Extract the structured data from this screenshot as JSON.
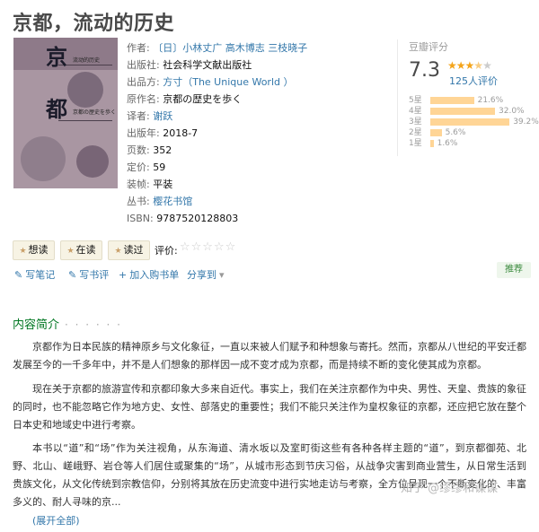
{
  "book": {
    "title": "京都，流动的历史",
    "info": [
      {
        "label": "作者:",
        "value": "〔日〕小林丈广 高木博志 三枝晓子",
        "link": true
      },
      {
        "label": "出版社:",
        "value": "社会科学文献出版社",
        "link": false
      },
      {
        "label": "出品方:",
        "value": "方寸（The Unique World ）",
        "link": true
      },
      {
        "label": "原作名:",
        "value": "京都の歴史を歩く",
        "link": false
      },
      {
        "label": "译者:",
        "value": "谢跃",
        "link": true
      },
      {
        "label": "出版年:",
        "value": "2018-7",
        "link": false
      },
      {
        "label": "页数:",
        "value": "352",
        "link": false
      },
      {
        "label": "定价:",
        "value": "59",
        "link": false
      },
      {
        "label": "装帧:",
        "value": "平装",
        "link": false
      },
      {
        "label": "丛书:",
        "value": "樱花书馆",
        "link": true
      },
      {
        "label": "ISBN:",
        "value": "9787520128803",
        "link": false
      }
    ],
    "cover": {
      "chars": [
        "京",
        "都"
      ],
      "small_text": [
        "流动的历史",
        "京都の歴史を歩く"
      ],
      "colors": {
        "bg": "#a996a2",
        "band": "#8e7a89"
      }
    }
  },
  "rating": {
    "label": "豆瓣评分",
    "score": "7.3",
    "stars_filled": 3.5,
    "count": "125人评价",
    "breakdown": [
      {
        "label": "5星",
        "pct": "21.6%",
        "value": 21.6
      },
      {
        "label": "4星",
        "pct": "32.0%",
        "value": 32.0
      },
      {
        "label": "3星",
        "pct": "39.2%",
        "value": 39.2
      },
      {
        "label": "2星",
        "pct": "5.6%",
        "value": 5.6
      },
      {
        "label": "1星",
        "pct": "1.6%",
        "value": 1.6
      }
    ],
    "bar_color": "#ffd596"
  },
  "buttons": {
    "want": "想读",
    "reading": "在读",
    "read": "读过",
    "rate_label": "评价:",
    "rate_stars": "☆☆☆☆☆"
  },
  "actions": {
    "note": "写笔记",
    "review": "写书评",
    "cart": "加入购书单",
    "share": "分享到",
    "recommend": "推荐"
  },
  "intro": {
    "heading": "内容简介",
    "dots": "· · · · · ·",
    "paragraphs": [
      "京都作为日本民族的精神原乡与文化象征，一直以来被人们赋予和种想象与寄托。然而，京都从八世纪的平安迁都发展至今的一千多年中，并不是人们想象的那样因一成不变才成为京都，而是持续不断的变化使其成为京都。",
      "现在关于京都的旅游宣传和京都印象大多来自近代。事实上，我们在关注京都作为中央、男性、天皇、贵族的象征的同时，也不能忽略它作为地方史、女性、部落史的重要性；我们不能只关注作为皇权象征的京都，还应把它放在整个日本史和地域史中进行考察。",
      "本书以“道”和“场”作为关注视角，从东海道、清水坂以及室町街这些有各种各样主题的“道”，到京都御苑、北野、北山、嵯峨野、岩仓等人们居住或聚集的“场”，从城市形态到节庆习俗，从战争灾害到商业营生，从日常生活到贵族文化，从文化传统到宗教信仰，分别将其放在历史流变中进行实地走访与考察，全方位呈现一个不断变化的、丰富多义的、耐人寻味的京..."
    ],
    "expand": "(展开全部)"
  },
  "watermark": "知乎 @缪缪和谋谋"
}
